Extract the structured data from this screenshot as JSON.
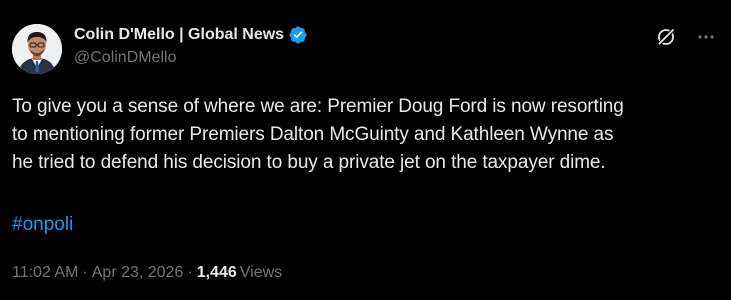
{
  "author": {
    "display_name": "Colin D'Mello | Global News",
    "handle": "@ColinDMello",
    "verified": true,
    "verified_color": "#1d9bf0",
    "avatar_icon": "profile-photo"
  },
  "actions": {
    "grok_icon": "grok-icon",
    "more_icon": "more-horizontal-icon"
  },
  "tweet": {
    "text": "To give you a sense of where we are: Premier Doug Ford is now resorting\nto mentioning former Premiers Dalton McGuinty and Kathleen Wynne as\nhe tried to defend his decision to buy a private jet on the taxpayer dime.",
    "hashtag": "#onpoli",
    "hashtag_color": "#1d9bf0"
  },
  "meta": {
    "time": "11:02 AM",
    "separator1": "·",
    "date": "Apr 23, 2026",
    "separator2": "·",
    "views_count": "1,446",
    "views_label": "Views"
  }
}
